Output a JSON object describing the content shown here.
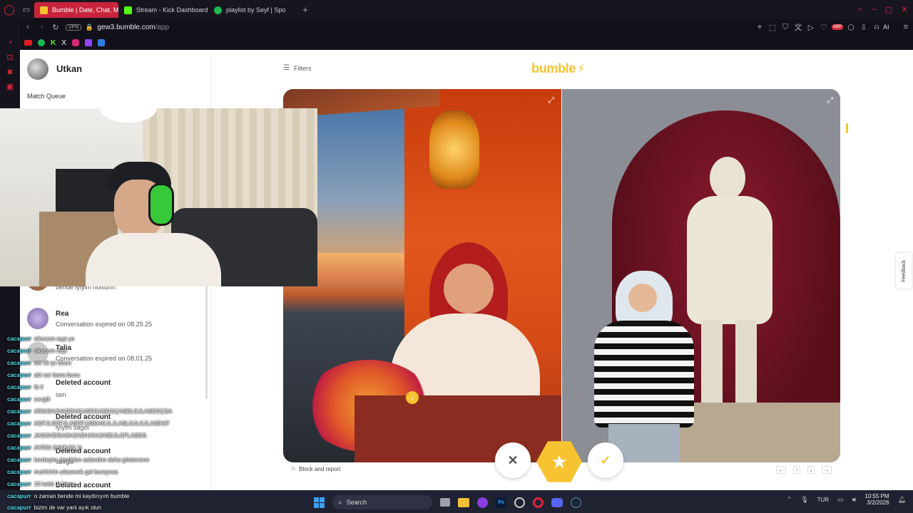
{
  "browser": {
    "tabs": [
      {
        "label": "Bumble | Date, Chat, Meet",
        "active": true,
        "color": "#f7c331"
      },
      {
        "label": "Stream - Kick Dashboard",
        "active": false,
        "color": "#53fc18"
      },
      {
        "label": "playlist by Seyf | Spo",
        "active": false,
        "color": "#1db954"
      }
    ],
    "vpn_label": "VPN",
    "url_host": "gew3.bumble.com",
    "url_path": "/app",
    "ai_label": "AI"
  },
  "sidebar": {
    "user_name": "Utkan",
    "match_queue_label": "Match Queue",
    "conversations": [
      {
        "name": "",
        "sub": "bende iyiyim nolsunn"
      },
      {
        "name": "Rea",
        "sub": "Conversation expired on 08.29.25"
      },
      {
        "name": "Talia",
        "sub": "Conversation expired on 08.01.25"
      },
      {
        "name": "Deleted account",
        "sub": "sen"
      },
      {
        "name": "Deleted account",
        "sub": "iyiyim sagol"
      },
      {
        "name": "Deleted account",
        "sub": "sevgili"
      },
      {
        "name": "Deleted account",
        "sub": ""
      }
    ]
  },
  "main": {
    "filters_label": "Filters",
    "logo_text": "bumble",
    "block_report_label": "Block and report",
    "feedback_label": "Feedback",
    "nav_arrows": [
      "←",
      "↑",
      "↓",
      "→"
    ]
  },
  "stream_chat": [
    {
      "user": "cacapurr",
      "msg": "sikecem eşşi ya"
    },
    {
      "user": "cacapurr",
      "msg": "sikecem eşşi"
    },
    {
      "user": "cacapurr",
      "msg": "ser ilk iyi olsun"
    },
    {
      "user": "cacapurr",
      "msg": "abi sar bana bunu"
    },
    {
      "user": "cacapurr",
      "msg": "fb ll"
    },
    {
      "user": "cacapurr",
      "msg": "sevgili"
    },
    {
      "user": "cacapurr",
      "msg": "ARGGHJHASDHGASDGASDGÇASDLGJLASDGÇSA"
    },
    {
      "user": "cacapurr",
      "msg": "ADFJLSDFJLASDFJJSDAGJLJLASLGJLGJLASDGF"
    },
    {
      "user": "cacapurr",
      "msg": "JASGHDSAGHJASHJAHJASDJLGFLASDG"
    },
    {
      "user": "cacapurr",
      "msg": "AYRIN SAYKAN 1t"
    },
    {
      "user": "cacapurr",
      "msg": "kardeşim şimdiden aslandım daha göstereme"
    },
    {
      "user": "cacapurr",
      "msg": "muhhhhh utkanecik gel buraycaa"
    },
    {
      "user": "cacapurr",
      "msg": "10 kaldı 1t bunu"
    },
    {
      "user": "cacapurr",
      "msg": "o zaman bende mi kaydırıyım bumble"
    },
    {
      "user": "cacapurr",
      "msg": "bizim de var yani ayık olun"
    }
  ],
  "taskbar": {
    "search_label": "Search",
    "lang": "TUR",
    "time": "10:55 PM",
    "date": "3/2/2026"
  },
  "colors": {
    "bumble_yellow": "#f7c331",
    "tab_active": "#c8243c",
    "dark_bg": "#17161f"
  }
}
